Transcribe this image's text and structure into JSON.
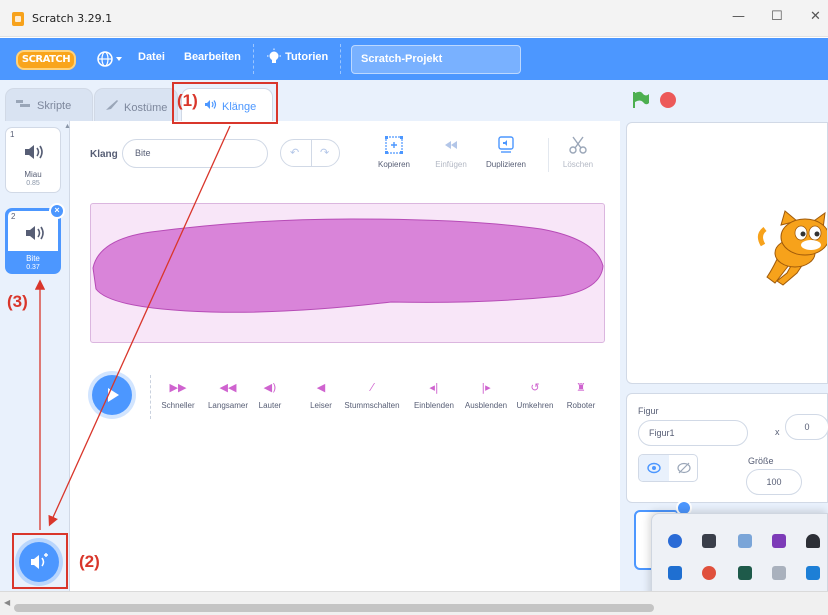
{
  "window": {
    "title": "Scratch 3.29.1",
    "minimize": "—",
    "maximize": "☐",
    "close": "✕"
  },
  "menubar": {
    "logo": "SCRATCH",
    "language_arrow": "▾",
    "file": "Datei",
    "edit": "Bearbeiten",
    "tutorials": "Tutorien",
    "project_title": "Scratch-Projekt"
  },
  "tabs": [
    {
      "label": "Skripte",
      "icon": "code-icon"
    },
    {
      "label": "Kostüme",
      "icon": "brush-icon"
    },
    {
      "label": "Klänge",
      "icon": "speaker-icon",
      "active": true
    }
  ],
  "sounds": [
    {
      "number": "1",
      "name": "Miau",
      "duration": "0.85"
    },
    {
      "number": "2",
      "name": "Bite",
      "duration": "0.37",
      "selected": true
    }
  ],
  "editor": {
    "sound_label": "Klang",
    "sound_name": "Bite",
    "tools": [
      {
        "label": "Kopieren",
        "enabled": true
      },
      {
        "label": "Einfügen",
        "enabled": false
      },
      {
        "label": "Duplizieren",
        "enabled": true
      },
      {
        "label": "Löschen",
        "enabled": false
      }
    ],
    "effects": [
      {
        "label": "Schneller",
        "icon": "faster-icon"
      },
      {
        "label": "Langsamer",
        "icon": "slower-icon"
      },
      {
        "label": "Lauter",
        "icon": "louder-icon"
      },
      {
        "label": "Leiser",
        "icon": "softer-icon"
      },
      {
        "label": "Stummschalten",
        "icon": "mute-icon"
      },
      {
        "label": "Einblenden",
        "icon": "fade-in-icon"
      },
      {
        "label": "Ausblenden",
        "icon": "fade-out-icon"
      },
      {
        "label": "Umkehren",
        "icon": "reverse-icon"
      },
      {
        "label": "Roboter",
        "icon": "robot-icon"
      }
    ],
    "waveform_color": "#cf63cf"
  },
  "sprite_info": {
    "sprite_label": "Figur",
    "sprite_name": "Figur1",
    "x_label": "x",
    "x_value": "0",
    "size_label": "Größe",
    "size_value": "100"
  },
  "annotations": {
    "step1": "(1)",
    "step2": "(2)",
    "step3": "(3)"
  },
  "colors": {
    "accent": "#4c97ff",
    "annotation": "#d9362b",
    "sound": "#cf63cf",
    "logo": "#f9a51c"
  }
}
